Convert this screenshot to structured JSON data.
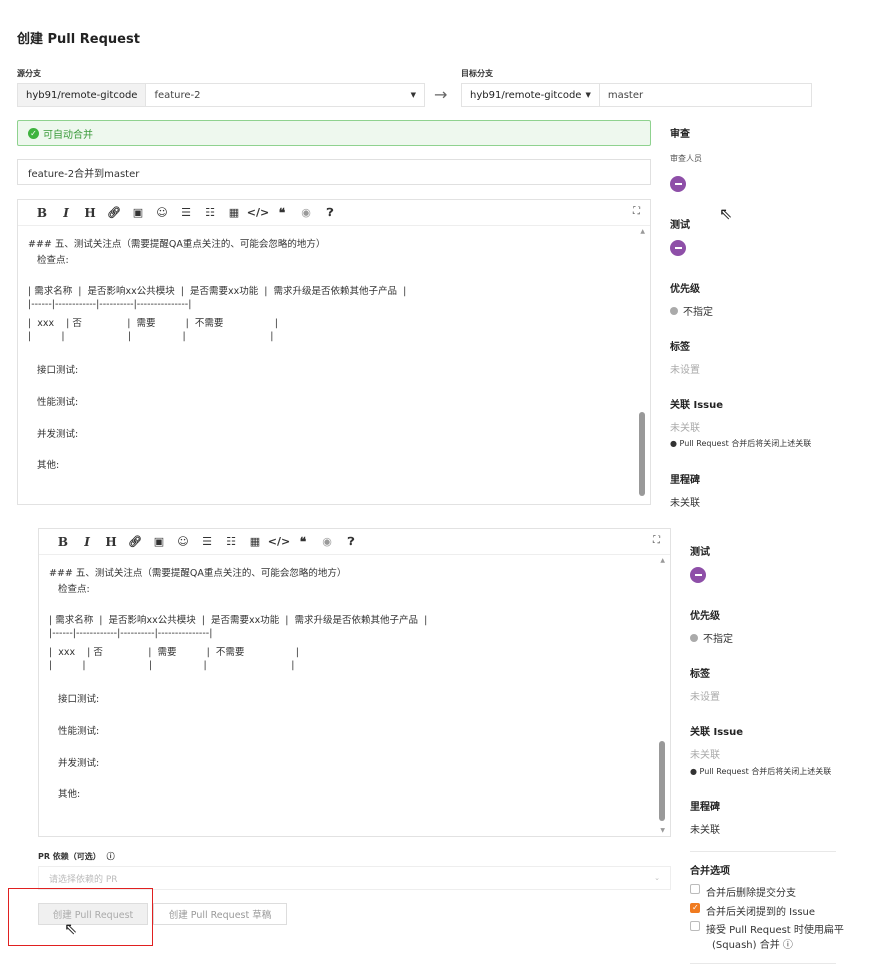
{
  "page": {
    "title": "创建 Pull Request"
  },
  "source": {
    "label": "源分支",
    "repo": "hyb91/remote-gitcode",
    "branch": "feature-2"
  },
  "target": {
    "label": "目标分支",
    "repo": "hyb91/remote-gitcode",
    "branch": "master"
  },
  "arrow": "→",
  "merge_status": "可自动合并",
  "pr_title": "feature-2合并到master",
  "toolbar": {
    "bold": "B",
    "italic": "I",
    "heading": "H"
  },
  "editor": {
    "lines": [
      "### 五、测试关注点（需要提醒QA重点关注的、可能会忽略的地方）",
      "   检查点:",
      "",
      "| 需求名称  |  是否影响xx公共模块  |  是否需要xx功能  |  需求升级是否依赖其他子产品  |",
      "|------|------------|----------|---------------|",
      "|  xxx    | 否               |  需要          |  不需要                 |",
      "|          |                     |                 |                            |",
      "",
      "   接口测试:",
      "",
      "   性能测试:",
      "",
      "   并发测试:",
      "",
      "   其他:"
    ]
  },
  "sidebar_top": {
    "review": {
      "title": "审查",
      "sub": "审查人员"
    },
    "test": {
      "title": "测试"
    },
    "priority": {
      "title": "优先级",
      "value": "不指定"
    },
    "labels": {
      "title": "标签",
      "value": "未设置"
    },
    "issue": {
      "title": "关联 Issue",
      "value": "未关联",
      "note": "Pull Request 合并后将关闭上述关联"
    },
    "milestone": {
      "title": "里程碑",
      "value": "未关联"
    }
  },
  "sidebar_bottom": {
    "test": {
      "title": "测试"
    },
    "priority": {
      "title": "优先级",
      "value": "不指定"
    },
    "labels": {
      "title": "标签",
      "value": "未设置"
    },
    "issue": {
      "title": "关联 Issue",
      "value": "未关联",
      "note": "Pull Request 合并后将关闭上述关联"
    },
    "milestone": {
      "title": "里程碑",
      "value": "未关联"
    },
    "merge_options": {
      "title": "合并选项",
      "opt1": "合并后删除提交分支",
      "opt2": "合并后关闭提到的 Issue",
      "opt3a": "接受 Pull Request 时使用扁平",
      "opt3b": "(Squash) 合并"
    }
  },
  "dependency": {
    "label": "PR 依赖（可选）",
    "placeholder": "请选择依赖的 PR"
  },
  "buttons": {
    "create": "创建 Pull Request",
    "create_draft": "创建 Pull Request 草稿"
  },
  "colors": {
    "accent": "#8e4fa8",
    "success": "#3fb33f",
    "checkbox": "#f07b1f",
    "highlight": "#e02020"
  }
}
